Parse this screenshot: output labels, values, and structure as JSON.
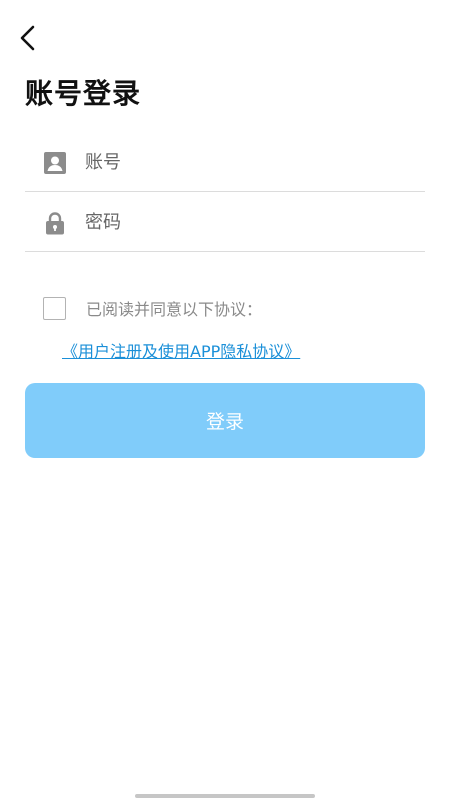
{
  "header": {
    "back_icon": "chevron-left-icon",
    "title": "账号登录"
  },
  "form": {
    "account": {
      "icon": "user-icon",
      "placeholder": "账号",
      "value": ""
    },
    "password": {
      "icon": "lock-icon",
      "placeholder": "密码",
      "value": ""
    }
  },
  "agreement": {
    "checked": false,
    "text": "已阅读并同意以下协议：",
    "link": "《用户注册及使用APP隐私协议》"
  },
  "login_button": {
    "label": "登录",
    "color": "#80ccfa"
  },
  "colors": {
    "link": "#1a8fd8",
    "icon": "#8c8c8c"
  }
}
